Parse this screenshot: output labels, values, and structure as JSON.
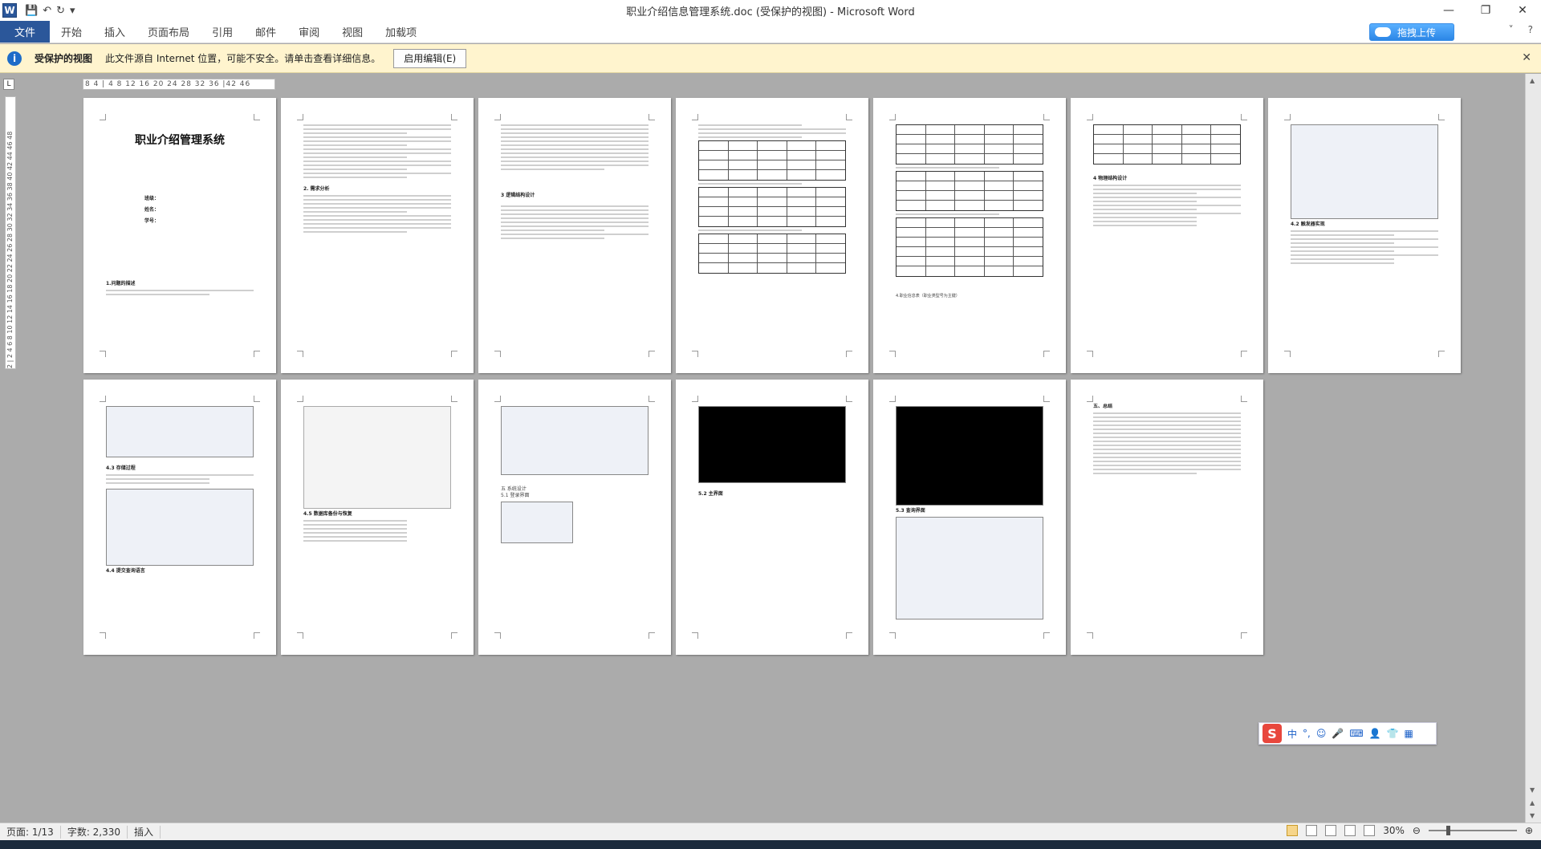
{
  "window": {
    "title": "职业介绍信息管理系统.doc (受保护的视图) - Microsoft Word",
    "app_icon": "W"
  },
  "quick_access": {
    "save_icon": "save-icon",
    "undo_icon": "undo-icon",
    "redo_icon": "redo-icon"
  },
  "ribbon": {
    "tabs": [
      "文件",
      "开始",
      "插入",
      "页面布局",
      "引用",
      "邮件",
      "审阅",
      "视图",
      "加载项"
    ],
    "upload_label": "拖拽上传"
  },
  "protected_view": {
    "label": "受保护的视图",
    "message": "此文件源自 Internet 位置，可能不安全。请单击查看详细信息。",
    "enable_button": "启用编辑(E)"
  },
  "rulers": {
    "horizontal": "8  4  | 4  8  12 16 20 24 28 32 36 |42 46",
    "vertical": "2 | 2  4  6  8  10 12 14 16 18 20 22 24 26 28 30 32 34 36 38 40 42 44 46 48"
  },
  "pages": {
    "p1_title": "职业介绍管理系统",
    "p1_fields": [
      "班级：",
      "姓名：",
      "学号："
    ],
    "p1_section": "1.问题的描述",
    "p2_section": "2. 需求分析",
    "p3_section": "3 逻辑结构设计",
    "p5_caption": "4.职业信息表（职业类型号为主键）",
    "p6_section": "4 物理结构设计",
    "p7_section": "4.2 触发器实现",
    "p8_section": "4.3 存储过程",
    "p8_section2": "4.4 提交查询语言",
    "p9_section": "4.5 数据库备份与恢复",
    "p10_section": "五 系统设计",
    "p10_sub": "5.1 登录界面",
    "p11_section": "5.2 主界面",
    "p12_section": "5.3 查询界面",
    "p13_section": "五、总结"
  },
  "ime": {
    "logo": "S",
    "items": [
      "中",
      "°,",
      "☺",
      "🎤",
      "⌨",
      "👤",
      "👕",
      "▦"
    ]
  },
  "status": {
    "page": "页面: 1/13",
    "words": "字数: 2,330",
    "mode": "插入",
    "zoom": "30%"
  }
}
